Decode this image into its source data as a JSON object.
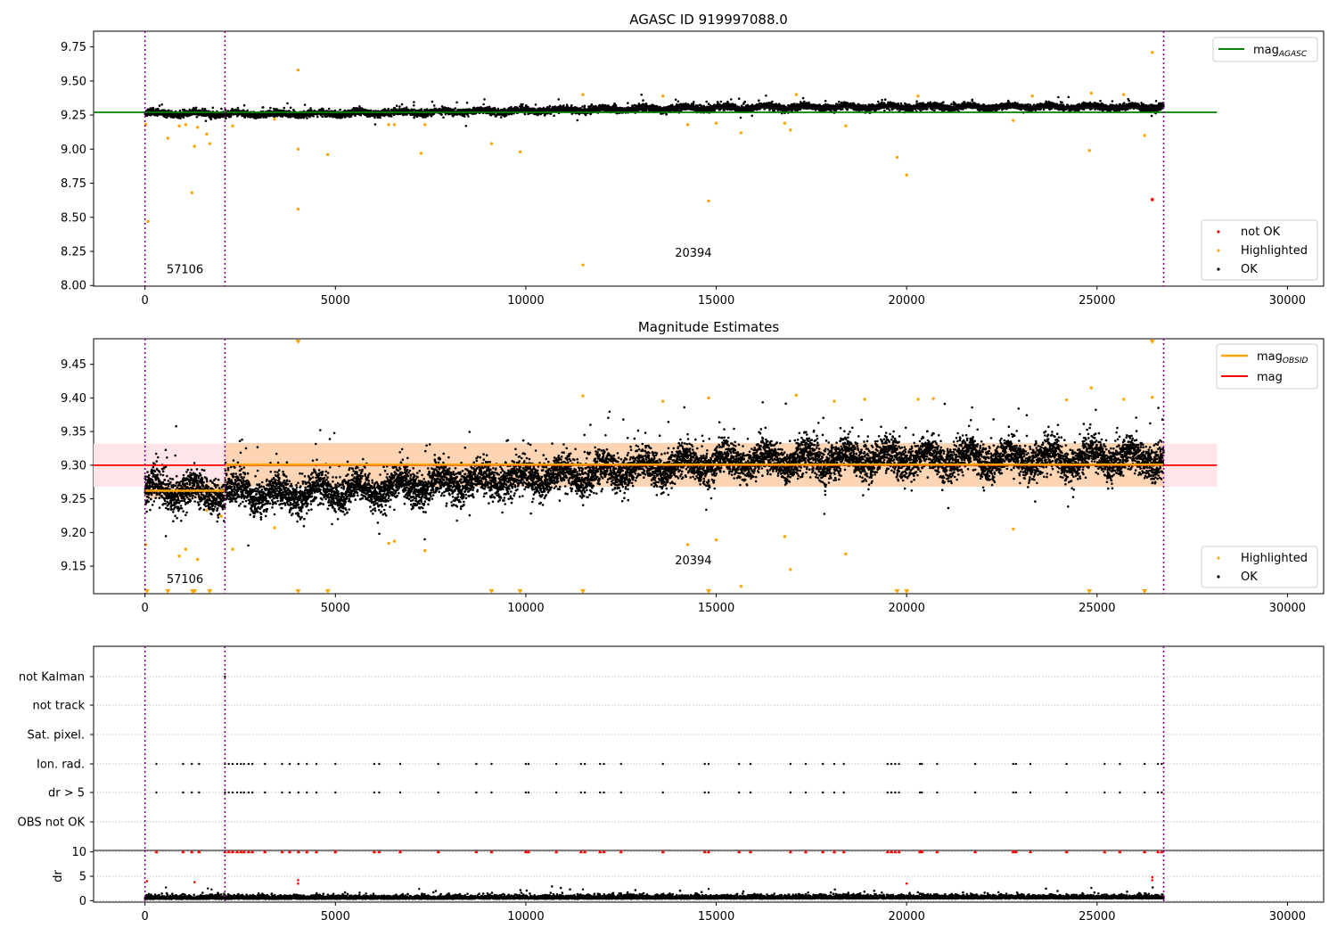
{
  "chart_data": [
    {
      "type": "scatter",
      "title": "AGASC ID 919997088.0",
      "xlabel": "",
      "ylabel": "",
      "xlim": [
        -1350,
        30950
      ],
      "ylim": [
        7.995,
        9.865
      ],
      "xticks": [
        0,
        5000,
        10000,
        15000,
        20000,
        25000,
        30000
      ],
      "xtick_labels": [
        "0",
        "5000",
        "10000",
        "15000",
        "20000",
        "25000",
        "30000"
      ],
      "yticks": [
        8.0,
        8.25,
        8.5,
        8.75,
        9.0,
        9.25,
        9.5,
        9.75
      ],
      "ytick_labels": [
        "8.00",
        "8.25",
        "8.50",
        "8.75",
        "9.00",
        "9.25",
        "9.50",
        "9.75"
      ],
      "obsid_boundaries": [
        0,
        2100,
        26750
      ],
      "obsid_annotations": [
        {
          "text": "57106",
          "x": 1050,
          "y": 8.09
        },
        {
          "text": "20394",
          "x": 14400,
          "y": 8.21
        }
      ],
      "mag_agasc": 9.27,
      "mag_agasc_x_range": [
        -1350,
        28150
      ],
      "ok_series": {
        "x_range": [
          0,
          26750
        ],
        "trend": [
          [
            0,
            9.265
          ],
          [
            2100,
            9.26
          ],
          [
            3500,
            9.255
          ],
          [
            7000,
            9.27
          ],
          [
            11000,
            9.285
          ],
          [
            14000,
            9.3
          ],
          [
            17000,
            9.31
          ],
          [
            20000,
            9.31
          ],
          [
            26750,
            9.31
          ]
        ]
      },
      "highlighted": [
        {
          "x": 20,
          "y": 9.18
        },
        {
          "x": 80,
          "y": 8.47
        },
        {
          "x": 600,
          "y": 9.08
        },
        {
          "x": 900,
          "y": 9.17
        },
        {
          "x": 1070,
          "y": 9.18
        },
        {
          "x": 1230,
          "y": 8.68
        },
        {
          "x": 1300,
          "y": 9.02
        },
        {
          "x": 1380,
          "y": 9.16
        },
        {
          "x": 1620,
          "y": 9.11
        },
        {
          "x": 1700,
          "y": 9.04
        },
        {
          "x": 2300,
          "y": 9.17
        },
        {
          "x": 3400,
          "y": 9.22
        },
        {
          "x": 4020,
          "y": 9.58
        },
        {
          "x": 4020,
          "y": 9.0
        },
        {
          "x": 4020,
          "y": 8.56
        },
        {
          "x": 4800,
          "y": 8.96
        },
        {
          "x": 6400,
          "y": 9.18
        },
        {
          "x": 6550,
          "y": 9.18
        },
        {
          "x": 7250,
          "y": 8.97
        },
        {
          "x": 7350,
          "y": 9.18
        },
        {
          "x": 9100,
          "y": 9.04
        },
        {
          "x": 9850,
          "y": 8.98
        },
        {
          "x": 11500,
          "y": 9.4
        },
        {
          "x": 11500,
          "y": 8.15
        },
        {
          "x": 14250,
          "y": 9.18
        },
        {
          "x": 14800,
          "y": 8.62
        },
        {
          "x": 15000,
          "y": 9.19
        },
        {
          "x": 15650,
          "y": 9.12
        },
        {
          "x": 16800,
          "y": 9.19
        },
        {
          "x": 16950,
          "y": 9.14
        },
        {
          "x": 18400,
          "y": 9.17
        },
        {
          "x": 19750,
          "y": 8.94
        },
        {
          "x": 20000,
          "y": 8.81
        },
        {
          "x": 22800,
          "y": 9.21
        },
        {
          "x": 24800,
          "y": 8.99
        },
        {
          "x": 26250,
          "y": 9.1
        },
        {
          "x": 26450,
          "y": 9.71
        },
        {
          "x": 13600,
          "y": 9.39
        },
        {
          "x": 17100,
          "y": 9.4
        },
        {
          "x": 20300,
          "y": 9.39
        },
        {
          "x": 23300,
          "y": 9.39
        },
        {
          "x": 24850,
          "y": 9.41
        },
        {
          "x": 25700,
          "y": 9.4
        }
      ],
      "not_ok": [
        {
          "x": 26450,
          "y": 8.63
        }
      ],
      "legend_lines": [
        "mag",
        "AGASC"
      ],
      "legend_scatter": [
        "not OK",
        "Highlighted",
        "OK"
      ],
      "legend_lines_position": "upper right",
      "legend_scatter_position": "lower right",
      "colors": {
        "ok": "#000000",
        "highlighted": "#ffa500",
        "not_ok": "#ff0000",
        "agasc_line": "#008000",
        "obsid_line": "#800080"
      }
    },
    {
      "type": "scatter",
      "title": "Magnitude Estimates",
      "xlabel": "",
      "ylabel": "",
      "xlim": [
        -1350,
        30950
      ],
      "ylim": [
        9.109,
        9.488
      ],
      "xticks": [
        0,
        5000,
        10000,
        15000,
        20000,
        25000,
        30000
      ],
      "xtick_labels": [
        "0",
        "5000",
        "10000",
        "15000",
        "20000",
        "25000",
        "30000"
      ],
      "yticks": [
        9.15,
        9.2,
        9.25,
        9.3,
        9.35,
        9.4,
        9.45
      ],
      "ytick_labels": [
        "9.15",
        "9.20",
        "9.25",
        "9.30",
        "9.35",
        "9.40",
        "9.45"
      ],
      "obsid_boundaries": [
        0,
        2100,
        26750
      ],
      "obsid_annotations": [
        {
          "text": "57106",
          "x": 1050,
          "y": 9.125
        },
        {
          "text": "20394",
          "x": 14400,
          "y": 9.153
        }
      ],
      "mag": 9.3,
      "mag_band": [
        9.268,
        9.332
      ],
      "mag_band_x_range": [
        -1350,
        28150
      ],
      "mag_obsid": [
        {
          "x": [
            0,
            2100
          ],
          "mag": 9.262,
          "band": [
            9.25,
            9.274
          ]
        },
        {
          "x": [
            2100,
            26750
          ],
          "mag": 9.301,
          "band": [
            9.268,
            9.333
          ]
        }
      ],
      "ok_series": {
        "x_range": [
          0,
          26750
        ],
        "trend": [
          [
            0,
            9.262
          ],
          [
            2100,
            9.26
          ],
          [
            3500,
            9.255
          ],
          [
            7000,
            9.27
          ],
          [
            11000,
            9.285
          ],
          [
            14000,
            9.3
          ],
          [
            17000,
            9.31
          ],
          [
            20000,
            9.31
          ],
          [
            26750,
            9.31
          ]
        ]
      },
      "highlighted": [
        {
          "x": 20,
          "y": 9.182
        },
        {
          "x": 900,
          "y": 9.165
        },
        {
          "x": 1070,
          "y": 9.175
        },
        {
          "x": 1380,
          "y": 9.16
        },
        {
          "x": 1620,
          "y": 9.233
        },
        {
          "x": 2000,
          "y": 9.224
        },
        {
          "x": 2300,
          "y": 9.175
        },
        {
          "x": 3400,
          "y": 9.207
        },
        {
          "x": 6400,
          "y": 9.184
        },
        {
          "x": 6550,
          "y": 9.187
        },
        {
          "x": 7350,
          "y": 9.173
        },
        {
          "x": 11500,
          "y": 9.403
        },
        {
          "x": 14250,
          "y": 9.182
        },
        {
          "x": 15000,
          "y": 9.189
        },
        {
          "x": 15650,
          "y": 9.12
        },
        {
          "x": 16800,
          "y": 9.194
        },
        {
          "x": 16950,
          "y": 9.145
        },
        {
          "x": 18400,
          "y": 9.168
        },
        {
          "x": 22800,
          "y": 9.205
        },
        {
          "x": 13600,
          "y": 9.395
        },
        {
          "x": 14800,
          "y": 9.4
        },
        {
          "x": 17100,
          "y": 9.404
        },
        {
          "x": 18100,
          "y": 9.395
        },
        {
          "x": 18900,
          "y": 9.398
        },
        {
          "x": 20300,
          "y": 9.398
        },
        {
          "x": 20700,
          "y": 9.399
        },
        {
          "x": 24200,
          "y": 9.397
        },
        {
          "x": 24850,
          "y": 9.415
        },
        {
          "x": 25700,
          "y": 9.398
        },
        {
          "x": 26450,
          "y": 9.401
        }
      ],
      "clipped_high": [
        4020,
        26450
      ],
      "clipped_low": [
        50,
        600,
        1250,
        1300,
        1700,
        4020,
        4800,
        9100,
        9850,
        11500,
        14800,
        19750,
        20000,
        24800,
        26250
      ],
      "legend_lines": [
        "mag",
        "OBSID",
        "mag"
      ],
      "legend_scatter": [
        "Highlighted",
        "OK"
      ],
      "legend_lines_position": "upper right",
      "legend_scatter_position": "lower right",
      "colors": {
        "ok": "#000000",
        "highlighted": "#ffa500",
        "mag_line": "#ff0000",
        "mag_band": "#ffe4e8",
        "obsid_line": "#ffa500",
        "obsid_band": "#fdd5b4",
        "boundary": "#800080"
      }
    },
    {
      "type": "scatter",
      "title": "",
      "xlabel": "",
      "ylabel": "",
      "xlim": [
        -1350,
        30950
      ],
      "categories": [
        "not Kalman",
        "not track",
        "Sat. pixel.",
        "Ion. rad.",
        "dr > 5",
        "OBS not OK"
      ],
      "xticks": [
        0,
        5000,
        10000,
        15000,
        20000,
        25000,
        30000
      ],
      "obsid_boundaries": [
        0,
        2100,
        26750
      ],
      "flag_points": {
        "not Kalman": [
          2100
        ],
        "not track": [],
        "Sat. pixel.": [],
        "Ion. rad.": [
          300,
          1000,
          1230,
          1420,
          2100,
          2200,
          2300,
          2420,
          2520,
          2600,
          2720,
          2820,
          3150,
          3600,
          3800,
          4030,
          4250,
          4500,
          5000,
          6020,
          6150,
          6700,
          7700,
          8700,
          9100,
          10000,
          10070,
          10800,
          11450,
          11550,
          11950,
          12050,
          12500,
          13600,
          14700,
          14800,
          15600,
          15900,
          16950,
          17350,
          17800,
          18100,
          18350,
          19500,
          19600,
          19700,
          19800,
          20350,
          20400,
          20800,
          21800,
          22800,
          22870,
          23250,
          24200,
          25200,
          25600,
          26250,
          26600,
          26700
        ],
        "dr > 5": [
          300,
          1000,
          1230,
          1420,
          2100,
          2200,
          2300,
          2420,
          2520,
          2600,
          2720,
          2820,
          3150,
          3600,
          3800,
          4030,
          4250,
          4500,
          5000,
          6020,
          6150,
          6700,
          7700,
          8700,
          9100,
          10000,
          10070,
          10800,
          11450,
          11550,
          11950,
          12050,
          12500,
          13600,
          14700,
          14800,
          15600,
          15900,
          16950,
          17350,
          17800,
          18100,
          18350,
          19500,
          19600,
          19700,
          19800,
          20350,
          20400,
          20800,
          21800,
          22800,
          22870,
          23250,
          24200,
          25200,
          25600,
          26250,
          26600,
          26700
        ],
        "OBS not OK": []
      },
      "colors": {
        "points": "#000000",
        "boundary": "#800080",
        "grid": "#b0b0b0"
      }
    },
    {
      "type": "scatter",
      "title": "",
      "xlabel": "",
      "ylabel": "dr",
      "xlim": [
        -1350,
        30950
      ],
      "ylim": [
        -0.3,
        10.3
      ],
      "xticks": [
        0,
        5000,
        10000,
        15000,
        20000,
        25000,
        30000
      ],
      "xtick_labels": [
        "0",
        "5000",
        "10000",
        "15000",
        "20000",
        "25000",
        "30000"
      ],
      "yticks": [
        0,
        5,
        10
      ],
      "ytick_labels": [
        "0",
        "5",
        "10"
      ],
      "obsid_boundaries": [
        0,
        2100,
        26750
      ],
      "ok_series": {
        "x_range": [
          0,
          26750
        ],
        "trend": [
          [
            0,
            0.5
          ],
          [
            26750,
            0.6
          ]
        ]
      },
      "clipped_at_10": [
        300,
        1000,
        1230,
        1420,
        2100,
        2200,
        2300,
        2420,
        2520,
        2600,
        2720,
        2820,
        3150,
        3600,
        3800,
        4030,
        4250,
        4500,
        5000,
        6020,
        6150,
        6700,
        7700,
        8700,
        9100,
        10000,
        10070,
        10800,
        11450,
        11550,
        11950,
        12050,
        12500,
        13600,
        14700,
        14800,
        15600,
        15900,
        16950,
        17350,
        17800,
        18100,
        18350,
        19500,
        19600,
        19700,
        19800,
        20350,
        20400,
        20800,
        21800,
        22800,
        22870,
        23250,
        24200,
        25200,
        25600,
        26250,
        26600,
        26700
      ],
      "red_points": [
        {
          "x": 50,
          "y": 4.0
        },
        {
          "x": 1300,
          "y": 3.8
        },
        {
          "x": 4020,
          "y": 4.2
        },
        {
          "x": 4020,
          "y": 3.5
        },
        {
          "x": 20000,
          "y": 3.5
        },
        {
          "x": 26450,
          "y": 4.8
        },
        {
          "x": 26450,
          "y": 4.2
        }
      ],
      "black_outliers": [
        {
          "x": 550,
          "y": 2.7
        },
        {
          "x": 1650,
          "y": 2.5
        },
        {
          "x": 1750,
          "y": 2.3
        },
        {
          "x": 7200,
          "y": 2.4
        },
        {
          "x": 11500,
          "y": 2.3
        },
        {
          "x": 14800,
          "y": 2.4
        },
        {
          "x": 24850,
          "y": 2.6
        }
      ],
      "colors": {
        "ok": "#000000",
        "red": "#ff0000",
        "boundary": "#800080",
        "grid": "#b0b0b0"
      }
    }
  ]
}
